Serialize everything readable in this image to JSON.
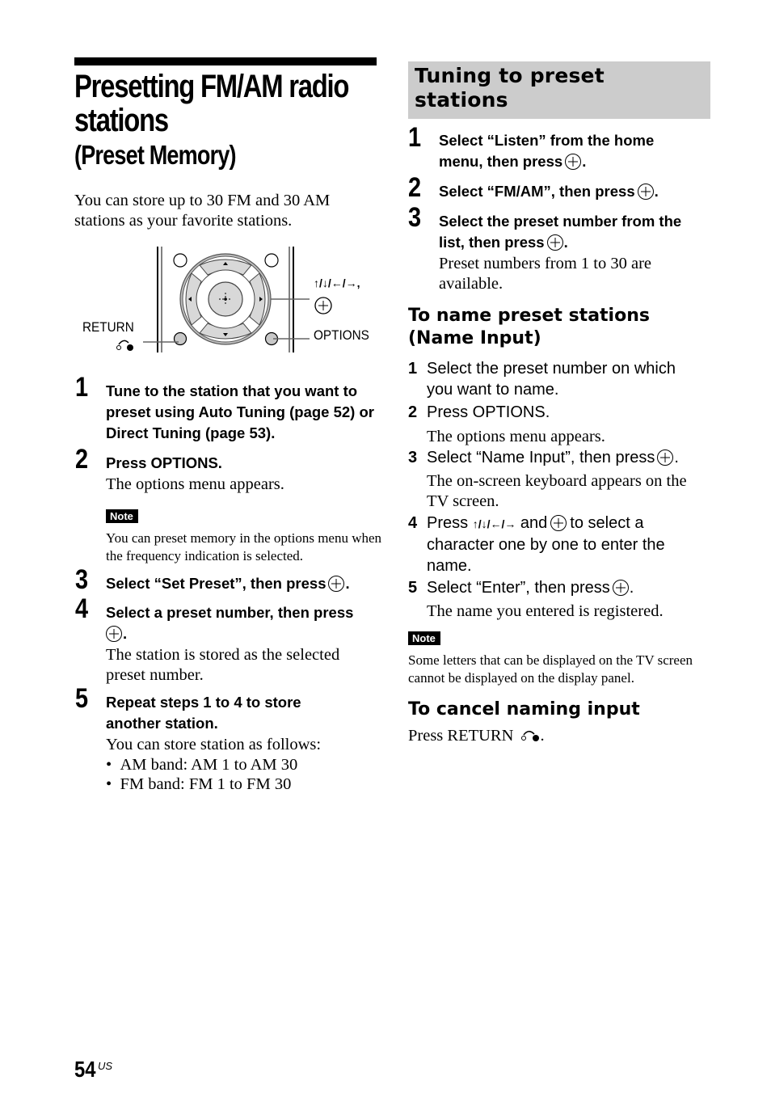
{
  "left": {
    "title": "Presetting FM/AM radio",
    "title_line2": "stations",
    "subtitle": "(Preset Memory)",
    "intro": "You can store up to 30 FM and 30 AM stations as your favorite stations.",
    "diagram": {
      "return_label": "RETURN",
      "options_label": "OPTIONS",
      "arrows_label": "↑/↓/←/→,",
      "icons": [
        "return-icon",
        "enter-icon",
        "arrow-keys-icon"
      ]
    },
    "steps": [
      {
        "num": "1",
        "head": "Tune to the station that you want to preset using Auto Tuning (page 52) or Direct Tuning (page 53)."
      },
      {
        "num": "2",
        "head": "Press OPTIONS.",
        "body": "The options menu appears."
      },
      {
        "num": "3",
        "head": "Select “Set Preset”, then press",
        "head_end": "."
      },
      {
        "num": "4",
        "head": "Select a preset number, then press",
        "head_end": ".",
        "body": "The station is stored as the selected preset number."
      },
      {
        "num": "5",
        "head": "Repeat steps 1 to 4 to store another station.",
        "body": "You can store station as follows:",
        "bullets": [
          "AM band: AM 1 to AM 30",
          "FM band: FM 1 to FM 30"
        ]
      }
    ],
    "note": {
      "label": "Note",
      "text": "You can preset memory in the options menu when the frequency indication is selected."
    }
  },
  "right": {
    "section_title_line1": "Tuning to preset",
    "section_title_line2": "stations",
    "steps": [
      {
        "num": "1",
        "head_line1": "Select “Listen” from the home",
        "head_line2": "menu, then press",
        "head_end": "."
      },
      {
        "num": "2",
        "head": "Select “FM/AM”, then press",
        "head_end": "."
      },
      {
        "num": "3",
        "head_line1": "Select the preset number from the",
        "head_line2": "list, then press",
        "head_end": ".",
        "body": "Preset numbers from 1 to 30 are available."
      }
    ],
    "name_input": {
      "title_line1": "To name preset stations",
      "title_line2": "(Name Input)",
      "steps": [
        {
          "num": "1",
          "text": "Select the preset number on which you want to name."
        },
        {
          "num": "2",
          "text": "Press OPTIONS.",
          "body": "The options menu appears."
        },
        {
          "num": "3",
          "text": "Select “Name Input”, then press",
          "text_end": ".",
          "body": "The on-screen keyboard appears on the TV screen."
        },
        {
          "num": "4",
          "text_pre": "Press",
          "arrows": "↑/↓/←/→",
          "text_mid": "and",
          "text_post": "to select a",
          "text_rest": "character one by one to enter the name."
        },
        {
          "num": "5",
          "text": "Select “Enter”, then press",
          "text_end": ".",
          "body": "The name you entered is registered."
        }
      ]
    },
    "note": {
      "label": "Note",
      "text": "Some letters that can be displayed on the TV screen cannot be displayed on the display panel."
    },
    "cancel": {
      "title": "To cancel naming input",
      "text": "Press RETURN",
      "text_end": "."
    }
  },
  "footer": {
    "page_number": "54",
    "region": "US"
  }
}
